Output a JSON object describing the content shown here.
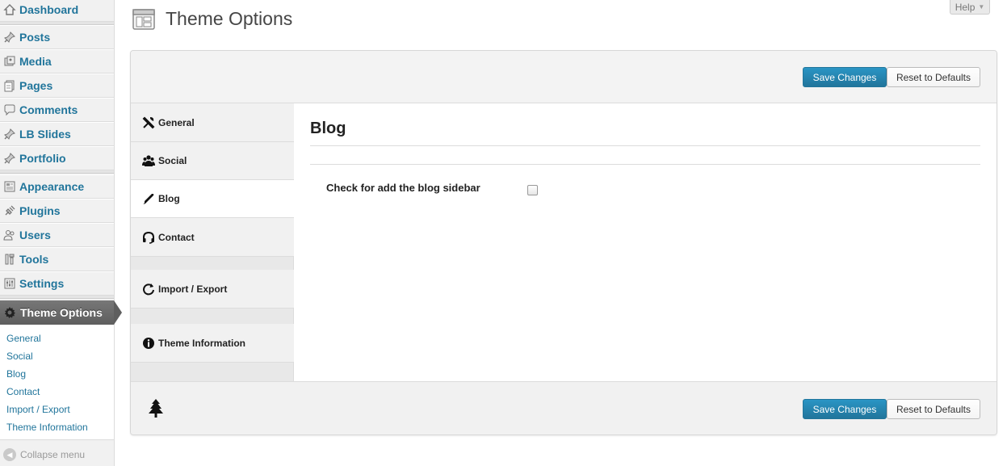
{
  "admin_menu": {
    "items": [
      {
        "label": "Dashboard",
        "icon": "dashboard-icon"
      },
      {
        "label": "Posts",
        "icon": "pin-icon"
      },
      {
        "label": "Media",
        "icon": "media-icon"
      },
      {
        "label": "Pages",
        "icon": "pages-icon"
      },
      {
        "label": "Comments",
        "icon": "comment-icon"
      },
      {
        "label": "LB Slides",
        "icon": "pin-icon"
      },
      {
        "label": "Portfolio",
        "icon": "pin-icon"
      },
      {
        "label": "Appearance",
        "icon": "appearance-icon"
      },
      {
        "label": "Plugins",
        "icon": "plugin-icon"
      },
      {
        "label": "Users",
        "icon": "users-icon"
      },
      {
        "label": "Tools",
        "icon": "tools-icon"
      },
      {
        "label": "Settings",
        "icon": "settings-icon"
      }
    ],
    "active": {
      "label": "Theme Options",
      "icon": "gear-icon"
    },
    "submenu": [
      "General",
      "Social",
      "Blog",
      "Contact",
      "Import / Export",
      "Theme Information"
    ],
    "collapse_label": "Collapse menu"
  },
  "header": {
    "title": "Theme Options",
    "help_label": "Help",
    "help_arrow": "▼"
  },
  "panel": {
    "save_label": "Save Changes",
    "reset_label": "Reset to Defaults",
    "tabs": [
      {
        "label": "General",
        "icon": "wrench-icon"
      },
      {
        "label": "Social",
        "icon": "users-icon"
      },
      {
        "label": "Blog",
        "icon": "pencil-icon"
      },
      {
        "label": "Contact",
        "icon": "headset-icon"
      },
      {
        "label": "Import / Export",
        "icon": "refresh-icon"
      },
      {
        "label": "Theme Information",
        "icon": "info-icon"
      }
    ],
    "active_tab": "Blog",
    "section_title": "Blog",
    "options": [
      {
        "label": "Check for add the blog sidebar",
        "checked": false
      }
    ],
    "footer_icon": "tree-icon"
  },
  "colors": {
    "link": "#21759b",
    "primary_button": "#21759b",
    "active_menu": "#5e5e5e"
  }
}
